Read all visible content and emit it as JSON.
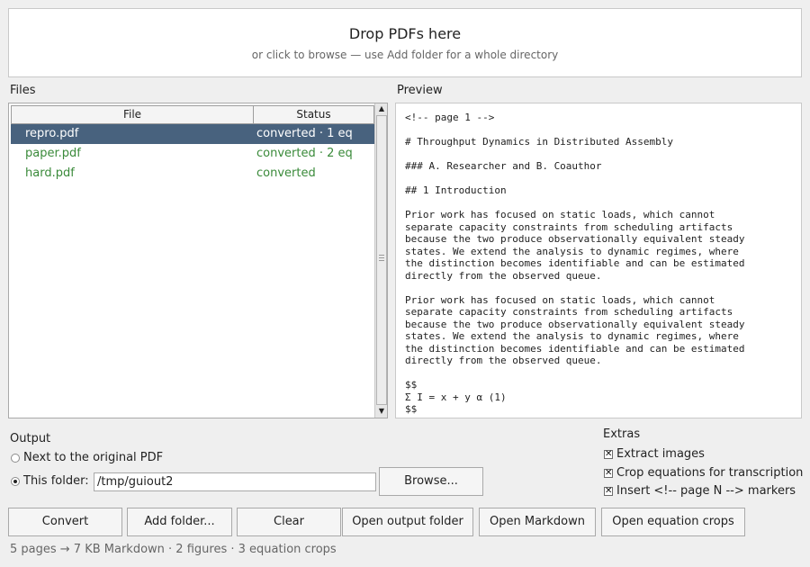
{
  "dropzone": {
    "title": "Drop PDFs here",
    "subtitle": "or click to browse — use Add folder for a whole directory"
  },
  "files": {
    "label": "Files",
    "columns": [
      "File",
      "Status"
    ],
    "rows": [
      {
        "file": "repro.pdf",
        "status": "converted · 1 eq",
        "selected": true
      },
      {
        "file": "paper.pdf",
        "status": "converted · 2 eq",
        "selected": false
      },
      {
        "file": "hard.pdf",
        "status": "converted",
        "selected": false
      }
    ]
  },
  "preview": {
    "label": "Preview",
    "text": "<!-- page 1 -->\n\n# Throughput Dynamics in Distributed Assembly\n\n### A. Researcher and B. Coauthor\n\n## 1 Introduction\n\nPrior work has focused on static loads, which cannot\nseparate capacity constraints from scheduling artifacts\nbecause the two produce observationally equivalent steady\nstates. We extend the analysis to dynamic regimes, where\nthe distinction becomes identifiable and can be estimated\ndirectly from the observed queue.\n\nPrior work has focused on static loads, which cannot\nseparate capacity constraints from scheduling artifacts\nbecause the two produce observationally equivalent steady\nstates. We extend the analysis to dynamic regimes, where\nthe distinction becomes identifiable and can be estimated\ndirectly from the observed queue.\n\n$$\nΣ I = x + y α (1)\n$$"
  },
  "output": {
    "label": "Output",
    "option_next": "Next to the original PDF",
    "option_folder": "This folder:",
    "folder_value": "/tmp/guiout2",
    "browse_label": "Browse..."
  },
  "extras": {
    "label": "Extras",
    "items": [
      {
        "label": "Extract images",
        "checked": true
      },
      {
        "label": "Crop equations for transcription",
        "checked": true
      },
      {
        "label": "Insert <!-- page N --> markers",
        "checked": true
      }
    ]
  },
  "actions": {
    "convert": "Convert",
    "add_folder": "Add folder...",
    "clear": "Clear",
    "open_output": "Open output folder",
    "open_markdown": "Open Markdown",
    "open_crops": "Open equation crops"
  },
  "status": "5 pages → 7 KB Markdown · 2 figures · 3 equation crops",
  "icons": {
    "scroll_up": "▲",
    "scroll_down": "▼",
    "check": "✕"
  }
}
